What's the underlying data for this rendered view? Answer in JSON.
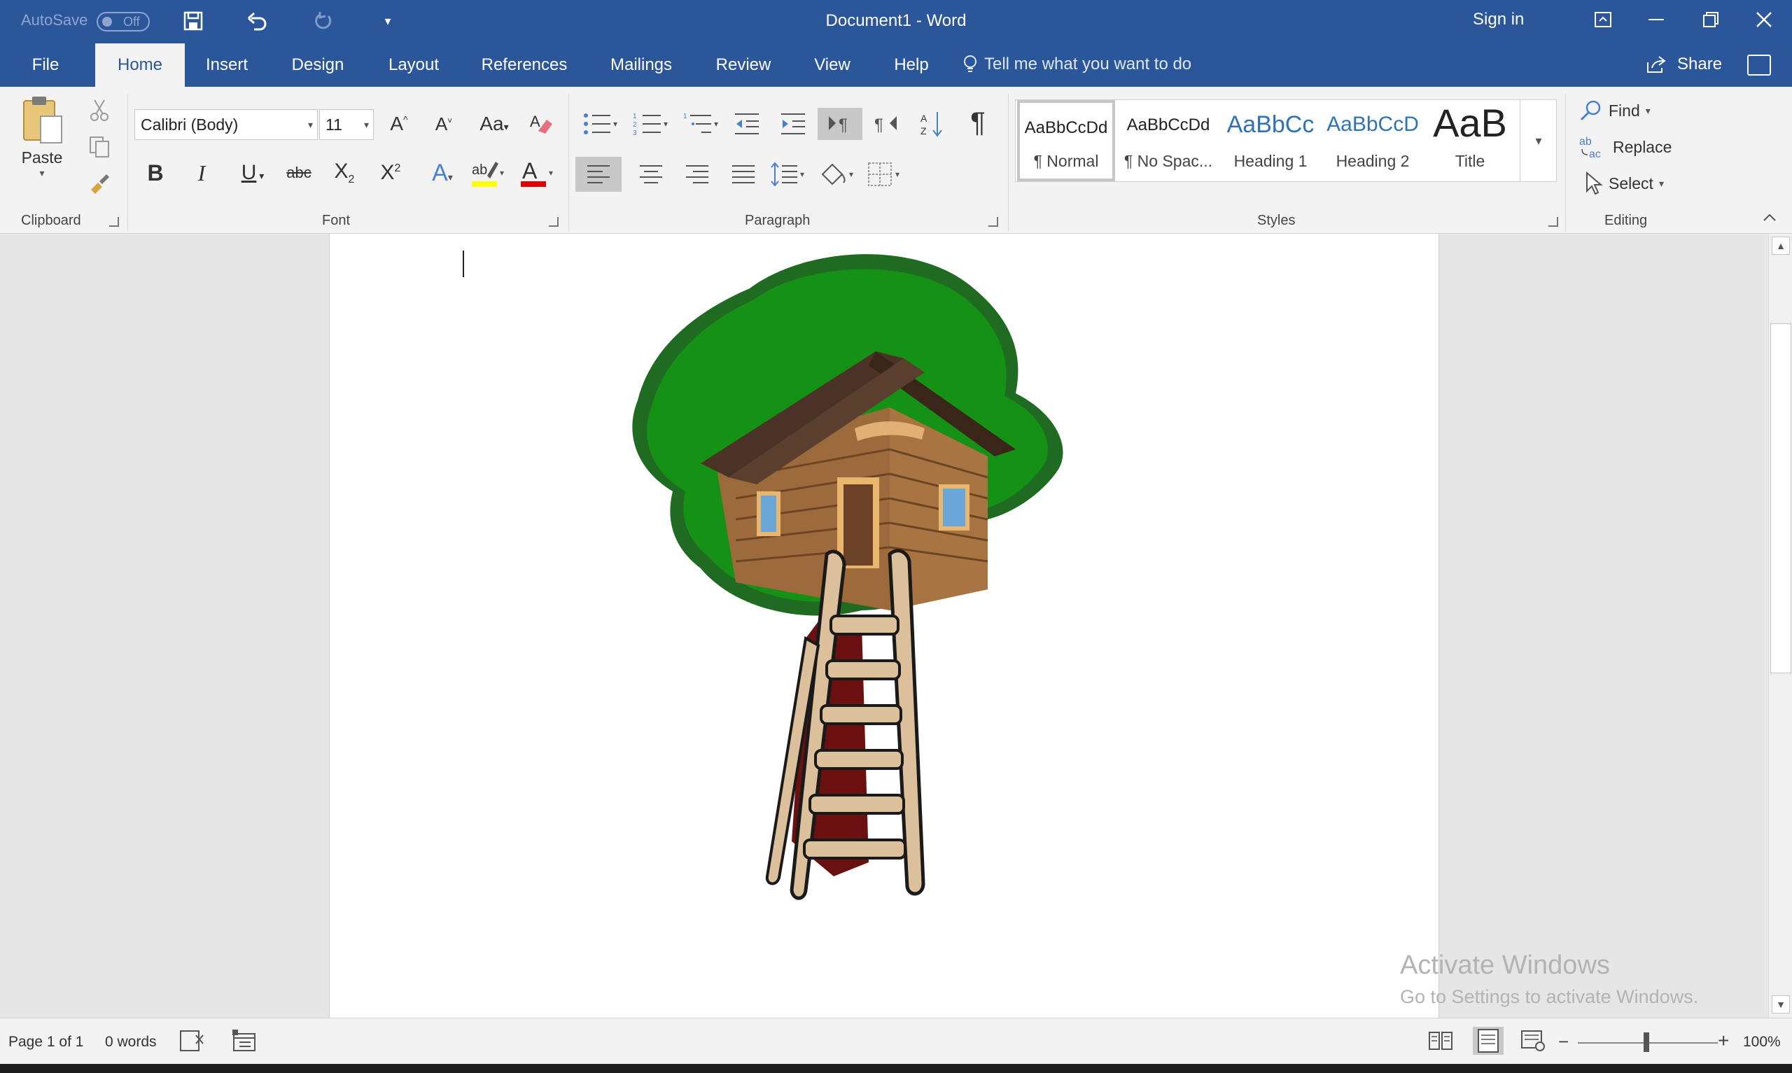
{
  "titlebar": {
    "autosave_label": "AutoSave",
    "autosave_state": "Off",
    "document_title": "Document1  -  Word",
    "sign_in": "Sign in",
    "accent_color": "#2b579a"
  },
  "tabs": [
    {
      "label": "File"
    },
    {
      "label": "Home"
    },
    {
      "label": "Insert"
    },
    {
      "label": "Design"
    },
    {
      "label": "Layout"
    },
    {
      "label": "References"
    },
    {
      "label": "Mailings"
    },
    {
      "label": "Review"
    },
    {
      "label": "View"
    },
    {
      "label": "Help"
    }
  ],
  "active_tab": "Home",
  "tell_me": "Tell me what you want to do",
  "share": "Share",
  "ribbon": {
    "clipboard": {
      "label": "Clipboard",
      "paste_label": "Paste"
    },
    "font": {
      "label": "Font",
      "font_name": "Calibri (Body)",
      "font_size": "11"
    },
    "paragraph": {
      "label": "Paragraph"
    },
    "styles": {
      "label": "Styles",
      "items": [
        {
          "sample": "AaBbCcDd",
          "name": "¶ Normal"
        },
        {
          "sample": "AaBbCcDd",
          "name": "¶ No Spac..."
        },
        {
          "sample": "AaBbCc",
          "name": "Heading 1"
        },
        {
          "sample": "AaBbCcD",
          "name": "Heading 2"
        },
        {
          "sample": "AaB",
          "name": "Title"
        }
      ]
    },
    "editing": {
      "label": "Editing",
      "find": "Find",
      "replace": "Replace",
      "select": "Select"
    }
  },
  "watermark": {
    "line1": "Activate Windows",
    "line2": "Go to Settings to activate Windows."
  },
  "statusbar": {
    "page": "Page 1 of 1",
    "words": "0 words",
    "zoom": "100%"
  }
}
